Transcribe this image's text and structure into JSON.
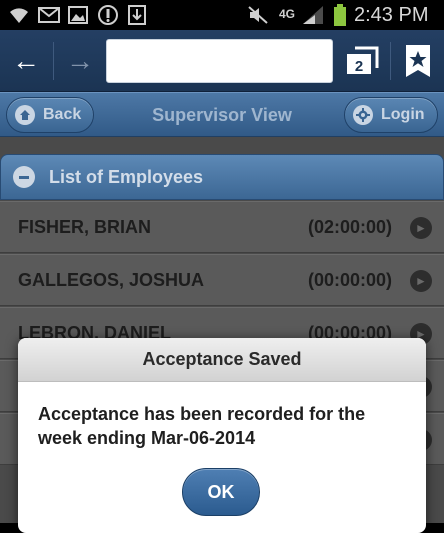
{
  "status_bar": {
    "time": "2:43 PM",
    "network": "4G",
    "icons": [
      "wifi-icon",
      "mail-icon",
      "image-icon",
      "upload-icon",
      "download-icon",
      "mute-icon",
      "signal-icon",
      "battery-icon"
    ]
  },
  "browser": {
    "back_glyph": "←",
    "forward_glyph": "→",
    "url_value": "",
    "tab_count": "2",
    "bookmark_glyph": "★"
  },
  "header": {
    "back_label": "Back",
    "title": "Supervisor View",
    "login_label": "Login"
  },
  "list": {
    "title": "List of Employees",
    "employees": [
      {
        "name": "FISHER, BRIAN",
        "duration": "(02:00:00)"
      },
      {
        "name": "GALLEGOS, JOSHUA",
        "duration": "(00:00:00)"
      },
      {
        "name": "LEBRON, DANIEL",
        "duration": "(00:00:00)"
      }
    ]
  },
  "dialog": {
    "title": "Acceptance Saved",
    "message": "Acceptance has been recorded for the week ending Mar-06-2014",
    "ok_label": "OK"
  },
  "colors": {
    "header_blue": "#3c6794",
    "overlay_gray": "#4a4a4a",
    "ok_button": "#2b5b8f"
  }
}
